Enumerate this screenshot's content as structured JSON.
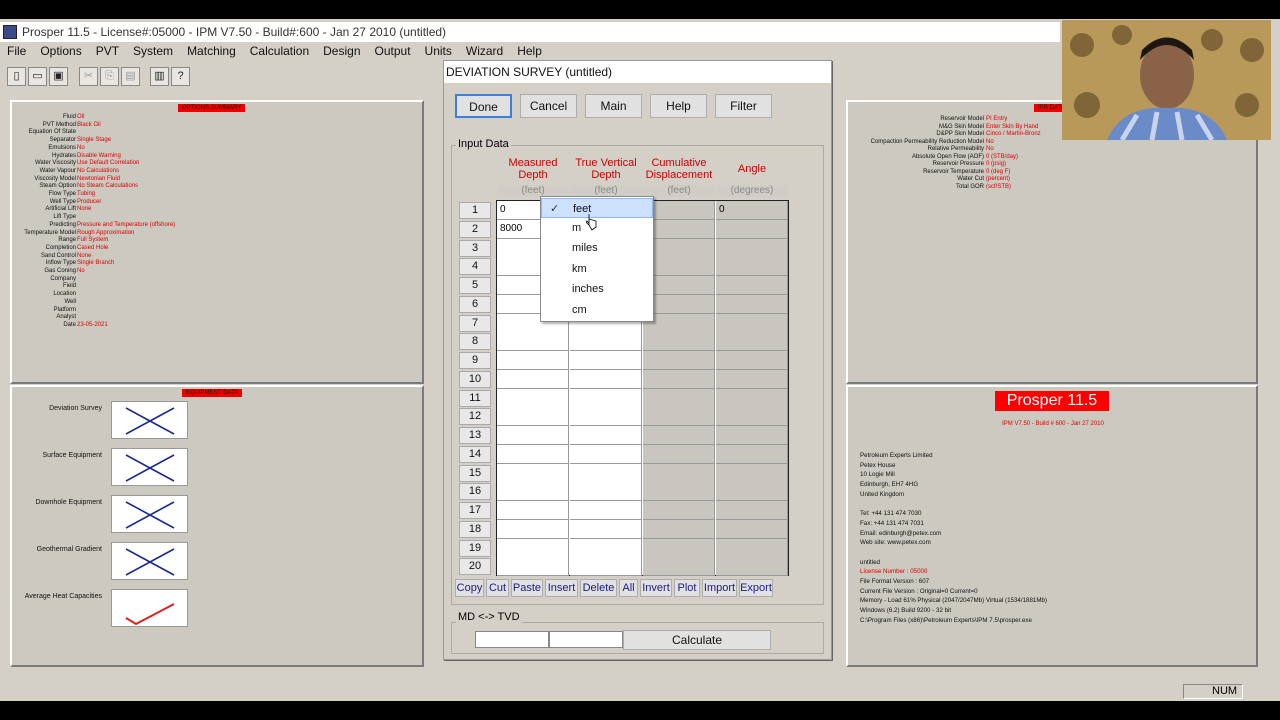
{
  "app": {
    "title": "Prosper 11.5 - License#:05000 - IPM V7.50 - Build#:600 - Jan 27 2010 (untitled)"
  },
  "menu": [
    "File",
    "Options",
    "PVT",
    "System",
    "Matching",
    "Calculation",
    "Design",
    "Output",
    "Units",
    "Wizard",
    "Help"
  ],
  "toolbar": {
    "icons": [
      "new-file-icon",
      "open-folder-icon",
      "save-icon",
      "cut-icon",
      "copy-icon",
      "paste-icon",
      "print-icon",
      "help-icon"
    ],
    "glyphs": [
      "▯",
      "📂",
      "💾",
      "✂",
      "⎘",
      "📋",
      "🖶",
      "?"
    ]
  },
  "options_summary": {
    "title": "OPTIONS SUMMARY",
    "rows": [
      {
        "k": "Fluid",
        "v": "Oil"
      },
      {
        "k": "PVT Method",
        "v": "Black Oil"
      },
      {
        "k": "Equation Of State",
        "v": ""
      },
      {
        "k": "Separator",
        "v": "Single Stage"
      },
      {
        "k": "Emulsions",
        "v": "No"
      },
      {
        "k": "Hydrates",
        "v": "Disable Warning"
      },
      {
        "k": "Water Viscosity",
        "v": "Use Default Correlation"
      },
      {
        "k": "Water Vapour",
        "v": "No Calculations"
      },
      {
        "k": "Viscosity Model",
        "v": "Newtonian Fluid"
      },
      {
        "k": "Steam Option",
        "v": "No Steam Calculations"
      },
      {
        "k": "Flow Type",
        "v": "Tubing"
      },
      {
        "k": "Well Type",
        "v": "Producer"
      },
      {
        "k": "Artificial Lift",
        "v": "None"
      },
      {
        "k": "Lift Type",
        "v": ""
      },
      {
        "k": "Predicting",
        "v": "Pressure and Temperature (offshore)"
      },
      {
        "k": "Temperature Model",
        "v": "Rough Approximation"
      },
      {
        "k": "Range",
        "v": "Full System"
      },
      {
        "k": "Completion",
        "v": "Cased Hole"
      },
      {
        "k": "Sand Control",
        "v": "None"
      },
      {
        "k": "Inflow Type",
        "v": "Single Branch"
      },
      {
        "k": "Gas Coning",
        "v": "No"
      },
      {
        "k": "Company",
        "v": ""
      },
      {
        "k": "Field",
        "v": ""
      },
      {
        "k": "Location",
        "v": ""
      },
      {
        "k": "Well",
        "v": ""
      },
      {
        "k": "Platform",
        "v": ""
      },
      {
        "k": "Analyst",
        "v": ""
      },
      {
        "k": "Date",
        "v": "23-05-2021"
      }
    ]
  },
  "equipment": {
    "title": "EQUIPMENT DATA",
    "items": [
      {
        "label": "Deviation Survey",
        "state": "cross"
      },
      {
        "label": "Surface Equipment",
        "state": "cross"
      },
      {
        "label": "Downhole Equipment",
        "state": "cross"
      },
      {
        "label": "Geothermal Gradient",
        "state": "cross"
      },
      {
        "label": "Average Heat Capacities",
        "state": "check"
      }
    ]
  },
  "ipr": {
    "title": "IPR DATA",
    "rows": [
      {
        "k": "Reservoir Model",
        "v": "PI Entry"
      },
      {
        "k": "M&G Skin Model",
        "v": "Enter Skin By Hand"
      },
      {
        "k": "D&PP Skin Model",
        "v": "Cinco / Martin-Bronz"
      },
      {
        "k": "Compaction Permeability Reduction Model",
        "v": "No"
      },
      {
        "k": "Relative Permeability",
        "v": "No"
      },
      {
        "k": "Absolute Open Flow (AOF)",
        "v": "0 (STB/day)"
      },
      {
        "k": "Reservoir Pressure",
        "v": "0 (psig)"
      },
      {
        "k": "Reservoir Temperature",
        "v": "0 (deg F)"
      },
      {
        "k": "Water Cut",
        "v": "(percent)"
      },
      {
        "k": "Total GOR",
        "v": "(scf/STB)"
      }
    ]
  },
  "about": {
    "badge": "Prosper 11.5",
    "sub": "IPM V7.50 - Build # 600 - Jan 27 2010",
    "lines": [
      "Petroleum Experts Limited",
      "Petex House",
      "10 Logie Mill",
      "Edinburgh, EH7 4HG",
      "United Kingdom",
      "",
      "Tel: +44 131 474 7030",
      "Fax: +44 131 474 7031",
      "Email: edinburgh@petex.com",
      "Web site: www.petex.com",
      "",
      "untitled"
    ],
    "license": "License Number : 05000",
    "lines2": [
      "File Format Version : 607",
      "Current File Version : Original=0 Current=0",
      "Memory - Load 61% Physical (2047/2047Mb) Virtual (1534/1881Mb)",
      "Windows (6.2) Build 9200 - 32 bit",
      "C:\\Program Files (x86)\\Petroleum Experts\\IPM 7.5\\prosper.exe"
    ]
  },
  "dialog": {
    "title": "DEVIATION SURVEY (untitled)",
    "buttons": [
      "Done",
      "Cancel",
      "Main",
      "Help",
      "Filter"
    ],
    "input_label": "Input Data",
    "columns": [
      "Measured Depth",
      "True Vertical Depth",
      "Cumulative Displacement",
      "Angle"
    ],
    "units": [
      "(feet)",
      "(feet)",
      "(feet)",
      "(degrees)"
    ],
    "row_numbers": [
      "1",
      "2",
      "3",
      "4",
      "5",
      "6",
      "7",
      "8",
      "9",
      "10",
      "11",
      "12",
      "13",
      "14",
      "15",
      "16",
      "17",
      "18",
      "19",
      "20"
    ],
    "row1": {
      "md": "0",
      "angle": "0"
    },
    "row2": {
      "md": "8000"
    },
    "small_buttons": [
      "Copy",
      "Cut",
      "Paste",
      "Insert",
      "Delete",
      "All",
      "Invert",
      "Plot",
      "Import",
      "Export"
    ],
    "md_tvd_label": "MD <-> TVD",
    "calculate": "Calculate"
  },
  "dropdown": {
    "options": [
      "feet",
      "m",
      "miles",
      "km",
      "inches",
      "cm"
    ],
    "selected": "feet",
    "check": "✓"
  },
  "status": {
    "num": "NUM"
  }
}
